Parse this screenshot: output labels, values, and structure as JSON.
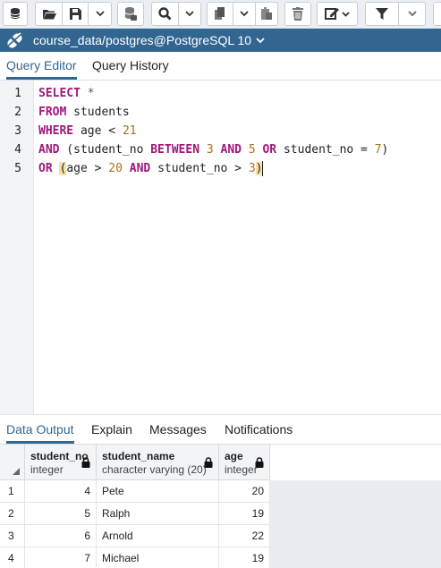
{
  "toolbar": {
    "buttons": [
      {
        "icon": "database-connect-icon"
      },
      {
        "icon": "open-folder-icon"
      },
      {
        "icon": "save-icon"
      },
      {
        "icon": "save-options-chevron-icon"
      },
      {
        "icon": "database-stack-icon"
      },
      {
        "icon": "search-icon"
      },
      {
        "icon": "copy-icon"
      },
      {
        "icon": "paste-icon"
      },
      {
        "icon": "delete-icon"
      },
      {
        "icon": "edit-icon"
      },
      {
        "icon": "filter-icon"
      }
    ]
  },
  "connection": {
    "label": "course_data/postgres@PostgreSQL 10",
    "icon": "connection-status-icon"
  },
  "editor_tabs": [
    {
      "label": "Query Editor",
      "active": true
    },
    {
      "label": "Query History",
      "active": false
    }
  ],
  "editor": {
    "line_numbers": [
      "1",
      "2",
      "3",
      "4",
      "5"
    ],
    "tokens": {
      "select": "SELECT",
      "star": " *",
      "from": "FROM",
      "students": " students",
      "where": "WHERE",
      "age_lt": " age < ",
      "n21": "21",
      "and": "AND",
      "l4_open": " (student_no ",
      "between": "BETWEEN",
      "n3": "3",
      "and2": "AND",
      "n5": "5",
      "or": "OR",
      "l4_mid": " student_no = ",
      "n7": "7",
      "l4_close": ")",
      "or2": "OR",
      "paren_open": "(",
      "l5_age": "age > ",
      "n20": "20",
      "and3": "AND",
      "l5_sno": " student_no > ",
      "n3b": "3",
      "paren_close": ")"
    }
  },
  "output_tabs": [
    {
      "label": "Data Output",
      "active": true
    },
    {
      "label": "Explain",
      "active": false
    },
    {
      "label": "Messages",
      "active": false
    },
    {
      "label": "Notifications",
      "active": false
    }
  ],
  "grid": {
    "columns": [
      {
        "name": "student_no",
        "type": "integer"
      },
      {
        "name": "student_name",
        "type": "character varying (20)"
      },
      {
        "name": "age",
        "type": "integer"
      }
    ],
    "rows": [
      {
        "n": "1",
        "student_no": "4",
        "student_name": "Pete",
        "age": "20"
      },
      {
        "n": "2",
        "student_no": "5",
        "student_name": "Ralph",
        "age": "19"
      },
      {
        "n": "3",
        "student_no": "6",
        "student_name": "Arnold",
        "age": "22"
      },
      {
        "n": "4",
        "student_no": "7",
        "student_name": "Michael",
        "age": "19"
      }
    ]
  },
  "colors": {
    "accent": "#326690",
    "keyword": "#a0177b",
    "number": "#ae6f1a"
  }
}
